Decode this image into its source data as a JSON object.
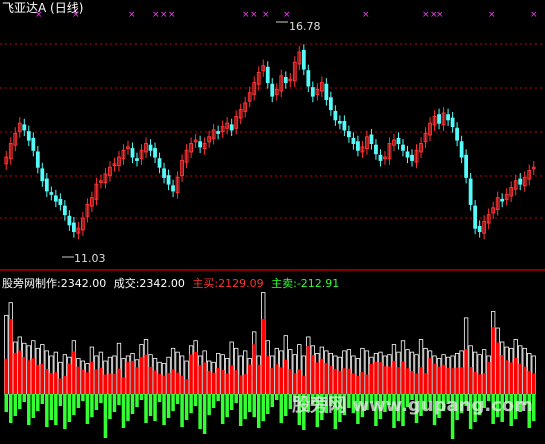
{
  "title": "飞亚达A (日线)",
  "markers_text": "×",
  "annotations": {
    "high": "16.78",
    "low": "11.03"
  },
  "indicator": {
    "name": "股旁网制作",
    "value1": ":2342.00",
    "vol_label": "成交:2342.00",
    "buy_label": "主买:2129.09",
    "sell_label": "主卖:-212.91"
  },
  "watermark": "股旁网 www.gupang.com",
  "colors": {
    "up": "#ff3333",
    "down": "#54fcfc",
    "buy": "#ff0000",
    "sell": "#33ff33",
    "grid": "#ff0000",
    "marker": "#ff33ff"
  },
  "chart_data": [
    {
      "type": "candlestick",
      "title": "飞亚达A (日线)",
      "ylim": [
        10.5,
        17.5
      ],
      "high": 16.78,
      "low": 11.03,
      "close": [
        13.6,
        14.0,
        14.3,
        14.6,
        14.4,
        14.1,
        13.8,
        13.3,
        12.9,
        12.6,
        12.5,
        12.3,
        12.2,
        11.9,
        11.6,
        11.4,
        11.5,
        11.8,
        12.2,
        12.4,
        12.8,
        12.9,
        13.1,
        13.3,
        13.4,
        13.6,
        13.8,
        13.9,
        13.6,
        13.5,
        13.8,
        14.0,
        13.8,
        13.6,
        13.3,
        13.0,
        12.8,
        12.6,
        13.0,
        13.5,
        13.8,
        14.0,
        14.1,
        13.9,
        14.0,
        14.2,
        14.4,
        14.3,
        14.5,
        14.6,
        14.4,
        14.8,
        15.0,
        15.2,
        15.5,
        15.8,
        16.1,
        16.3,
        15.8,
        15.4,
        15.6,
        16.0,
        15.8,
        15.9,
        16.4,
        16.7,
        16.2,
        15.7,
        15.4,
        15.6,
        15.8,
        15.3,
        15.0,
        14.7,
        14.6,
        14.4,
        14.2,
        14.0,
        13.8,
        13.9,
        14.2,
        14.0,
        13.7,
        13.5,
        13.6,
        14.0,
        14.1,
        14.0,
        13.8,
        13.6,
        13.5,
        13.8,
        14.0,
        14.3,
        14.6,
        14.8,
        14.6,
        14.9,
        14.7,
        14.5,
        14.1,
        13.6,
        13.0,
        12.2,
        11.5,
        11.4,
        11.7,
        11.9,
        12.1,
        12.4,
        12.3,
        12.5,
        12.7,
        12.9,
        12.8,
        13.0,
        13.2,
        13.3
      ],
      "volume": [
        620,
        720,
        410,
        450,
        400,
        380,
        420,
        360,
        390,
        340,
        300,
        330,
        250,
        310,
        290,
        420,
        280,
        260,
        240,
        370,
        300,
        330,
        260,
        290,
        300,
        400,
        280,
        300,
        320,
        270,
        390,
        430,
        310,
        280,
        250,
        240,
        290,
        360,
        330,
        300,
        260,
        380,
        420,
        300,
        340,
        260,
        250,
        320,
        310,
        280,
        410,
        360,
        300,
        340,
        280,
        490,
        300,
        800,
        420,
        300,
        360,
        340,
        460,
        350,
        310,
        390,
        300,
        450,
        380,
        320,
        370,
        340,
        320,
        300,
        290,
        340,
        350,
        300,
        280,
        360,
        340,
        290,
        320,
        330,
        300,
        310,
        390,
        330,
        420,
        350,
        330,
        310,
        430,
        360,
        340,
        300,
        280,
        310,
        290,
        300,
        320,
        340,
        600,
        380,
        330,
        310,
        350,
        300,
        650,
        520,
        410,
        370,
        360,
        430,
        380,
        360,
        320,
        300
      ]
    }
  ]
}
